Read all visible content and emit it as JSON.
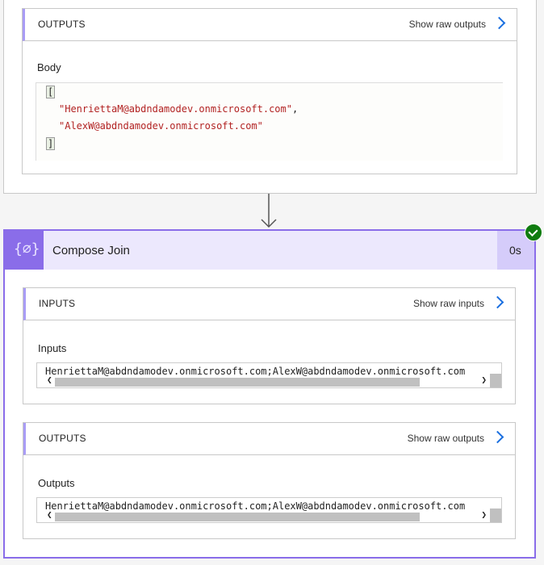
{
  "top_action": {
    "outputs": {
      "title": "OUTPUTS",
      "show_raw": "Show raw outputs",
      "body_label": "Body",
      "open_bracket": "[",
      "close_bracket": "]",
      "items": [
        "\"HenriettaM@abdndamodev.onmicrosoft.com\"",
        "\"AlexW@abdndamodev.onmicrosoft.com\""
      ],
      "comma": ","
    }
  },
  "compose": {
    "title": "Compose Join",
    "duration": "0s",
    "status": "succeeded",
    "icon": "compose-braces-icon",
    "accent": "#8a6de9",
    "inputs": {
      "title": "INPUTS",
      "show_raw": "Show raw inputs",
      "label": "Inputs",
      "value": "HenriettaM@abdndamodev.onmicrosoft.com;AlexW@abdndamodev.onmicrosoft.com"
    },
    "outputs": {
      "title": "OUTPUTS",
      "show_raw": "Show raw outputs",
      "label": "Outputs",
      "value": "HenriettaM@abdndamodev.onmicrosoft.com;AlexW@abdndamodev.onmicrosoft.com"
    }
  }
}
